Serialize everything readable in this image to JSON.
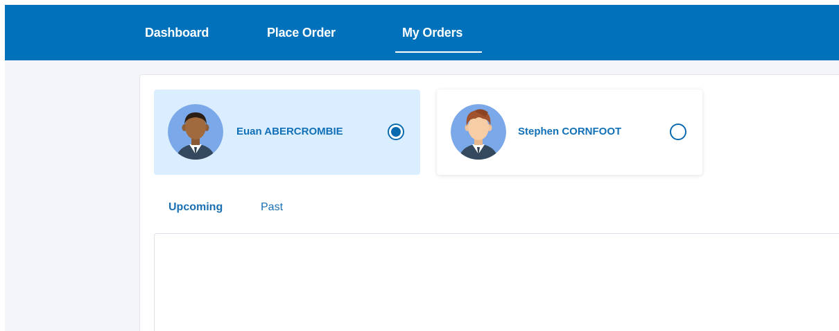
{
  "nav": {
    "items": [
      {
        "label": "Dashboard"
      },
      {
        "label": "Place Order"
      },
      {
        "label": "My Orders"
      }
    ],
    "active": "My Orders"
  },
  "people": [
    {
      "name": "Euan ABERCROMBIE",
      "selected": true,
      "avatar": "avatar-dark-hair-icon"
    },
    {
      "name": "Stephen CORNFOOT",
      "selected": false,
      "avatar": "avatar-brown-hair-icon"
    }
  ],
  "tabs": [
    {
      "label": "Upcoming",
      "active": true
    },
    {
      "label": "Past",
      "active": false
    }
  ],
  "colors": {
    "header": "#0072bb",
    "accent": "#1170b6",
    "selected_card": "#dbeeff",
    "page_bg": "#f4f5f8"
  }
}
